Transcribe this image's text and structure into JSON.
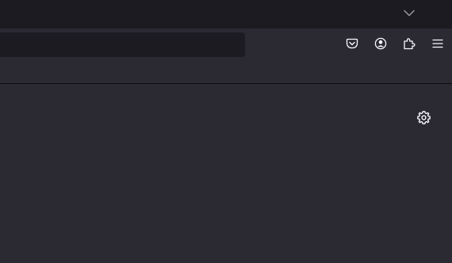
{
  "colors": {
    "titlebar_bg": "#1c1b22",
    "toolbar_bg": "#2b2a33",
    "urlbar_bg": "#1c1b22",
    "content_bg": "#2b2a33",
    "icon_color": "#fbfbfe",
    "divider": "#0c0c0d"
  },
  "titlebar": {
    "tab_list_icon": "chevron-down-icon"
  },
  "toolbar": {
    "urlbar_value": "",
    "icons": [
      "pocket-icon",
      "account-icon",
      "extensions-icon",
      "menu-icon"
    ]
  },
  "content": {
    "settings_icon": "gear-icon"
  }
}
